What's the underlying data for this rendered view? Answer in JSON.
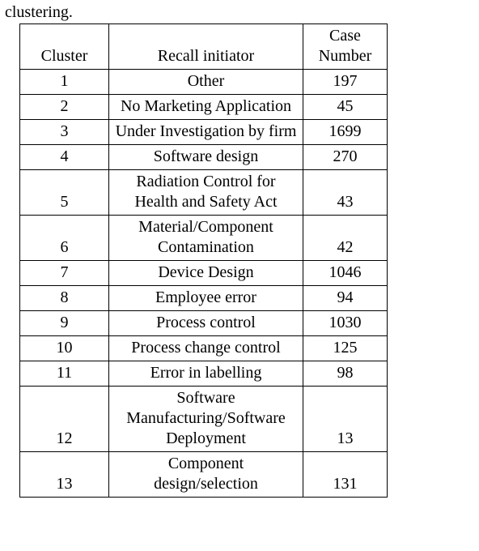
{
  "caption": "clustering.",
  "headers": {
    "cluster": "Cluster",
    "initiator": "Recall initiator",
    "case_number": "Case Number"
  },
  "chart_data": {
    "type": "table",
    "columns": [
      "Cluster",
      "Recall initiator",
      "Case Number"
    ],
    "rows": [
      {
        "cluster": "1",
        "initiator": "Other",
        "case_number": "197"
      },
      {
        "cluster": "2",
        "initiator": "No Marketing Application",
        "case_number": "45"
      },
      {
        "cluster": "3",
        "initiator": "Under Investigation by firm",
        "case_number": "1699"
      },
      {
        "cluster": "4",
        "initiator": "Software design",
        "case_number": "270"
      },
      {
        "cluster": "5",
        "initiator": "Radiation Control for Health and Safety Act",
        "case_number": "43"
      },
      {
        "cluster": "6",
        "initiator": "Material/Component Contamination",
        "case_number": "42"
      },
      {
        "cluster": "7",
        "initiator": "Device Design",
        "case_number": "1046"
      },
      {
        "cluster": "8",
        "initiator": "Employee error",
        "case_number": "94"
      },
      {
        "cluster": "9",
        "initiator": "Process control",
        "case_number": "1030"
      },
      {
        "cluster": "10",
        "initiator": "Process change control",
        "case_number": "125"
      },
      {
        "cluster": "11",
        "initiator": "Error in labelling",
        "case_number": "98"
      },
      {
        "cluster": "12",
        "initiator": "Software Manufacturing/Software Deployment",
        "case_number": "13"
      },
      {
        "cluster": "13",
        "initiator": "Component design/selection",
        "case_number": "131"
      }
    ]
  }
}
